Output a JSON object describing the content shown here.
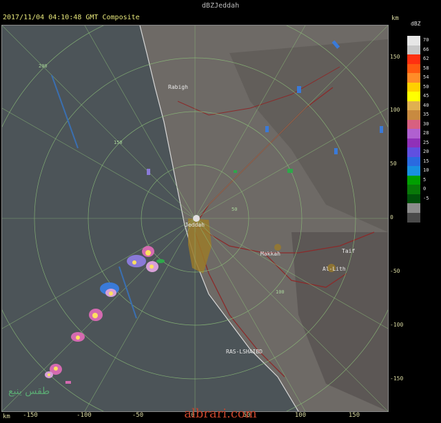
{
  "window": {
    "title": "dBZJeddah"
  },
  "header": {
    "timestamp": "2017/11/04 04:10:48 GMT Composite",
    "km_top": "km",
    "km_bottom": "km"
  },
  "legend": {
    "title": "dBZ",
    "levels": [
      {
        "value": "70",
        "color": "#e6e6e6"
      },
      {
        "value": "66",
        "color": "#c8c8c8"
      },
      {
        "value": "62",
        "color": "#ff3010"
      },
      {
        "value": "58",
        "color": "#ff5a10"
      },
      {
        "value": "54",
        "color": "#ff8c28"
      },
      {
        "value": "50",
        "color": "#ffd000"
      },
      {
        "value": "45",
        "color": "#ffff00"
      },
      {
        "value": "40",
        "color": "#e0b050"
      },
      {
        "value": "35",
        "color": "#c88a40"
      },
      {
        "value": "30",
        "color": "#d86080"
      },
      {
        "value": "28",
        "color": "#b060d0"
      },
      {
        "value": "25",
        "color": "#9030b8"
      },
      {
        "value": "20",
        "color": "#6050e0"
      },
      {
        "value": "15",
        "color": "#2a6ae0"
      },
      {
        "value": "10",
        "color": "#1890e0"
      },
      {
        "value": "5",
        "color": "#00a000"
      },
      {
        "value": "0",
        "color": "#087808"
      },
      {
        "value": "-5",
        "color": "#00500a"
      },
      {
        "value": "",
        "color": "#8c8c8c"
      },
      {
        "value": "",
        "color": "#4a4a4a"
      }
    ]
  },
  "axes": {
    "y_ticks": [
      "150",
      "100",
      "50",
      "0",
      "-50",
      "-100",
      "-150"
    ],
    "x_ticks": [
      "-150",
      "-100",
      "-50",
      "0",
      "50",
      "100",
      "150"
    ]
  },
  "range_rings": [
    "50",
    "100",
    "150",
    "200"
  ],
  "places": {
    "rabigh": "Rabigh",
    "jeddah": "Jeddah",
    "makkah": "Makkah",
    "taif": "Taif",
    "al_lith": "Al-Lith",
    "ras": "RAS-LSHAIBD"
  },
  "watermark": "albrari.com",
  "arabic_watermark": "طقس ينبع"
}
